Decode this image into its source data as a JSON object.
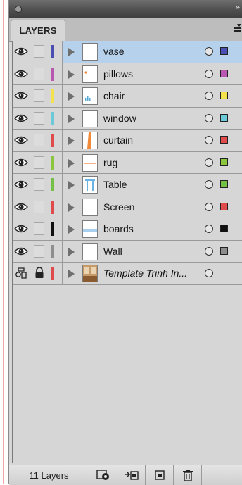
{
  "panel": {
    "tab_label": "LAYERS",
    "footer_count": "11 Layers"
  },
  "layers": [
    {
      "name": "vase",
      "color": "#4b4fb1",
      "selected": true,
      "visible": true,
      "locked": false,
      "italic": false,
      "thumb": "blank"
    },
    {
      "name": "pillows",
      "color": "#b858b0",
      "selected": false,
      "visible": true,
      "locked": false,
      "italic": false,
      "thumb": "pillows"
    },
    {
      "name": "chair",
      "color": "#f2e24c",
      "selected": false,
      "visible": true,
      "locked": false,
      "italic": false,
      "thumb": "chair"
    },
    {
      "name": "window",
      "color": "#6cc9d8",
      "selected": false,
      "visible": true,
      "locked": false,
      "italic": false,
      "thumb": "blank"
    },
    {
      "name": "curtain",
      "color": "#e04b4b",
      "selected": false,
      "visible": true,
      "locked": false,
      "italic": false,
      "thumb": "curtain"
    },
    {
      "name": "rug",
      "color": "#8cc63f",
      "selected": false,
      "visible": true,
      "locked": false,
      "italic": false,
      "thumb": "rug"
    },
    {
      "name": "Table",
      "color": "#74c044",
      "selected": false,
      "visible": true,
      "locked": false,
      "italic": false,
      "thumb": "table"
    },
    {
      "name": "Screen",
      "color": "#e04b4b",
      "selected": false,
      "visible": true,
      "locked": false,
      "italic": false,
      "thumb": "blank"
    },
    {
      "name": "boards",
      "color": "#111111",
      "selected": false,
      "visible": true,
      "locked": false,
      "italic": false,
      "thumb": "boards"
    },
    {
      "name": "Wall",
      "color": "#8e8e8e",
      "selected": false,
      "visible": true,
      "locked": false,
      "italic": false,
      "thumb": "blank"
    },
    {
      "name": "Template Trinh In...",
      "color": "#e04b4b",
      "selected": false,
      "visible": true,
      "locked": true,
      "italic": true,
      "thumb": "photo"
    }
  ],
  "footer_buttons": [
    {
      "icon": "make-clipping-mask-icon"
    },
    {
      "icon": "create-sublayer-icon"
    },
    {
      "icon": "create-new-layer-icon"
    },
    {
      "icon": "delete-layer-icon"
    }
  ]
}
